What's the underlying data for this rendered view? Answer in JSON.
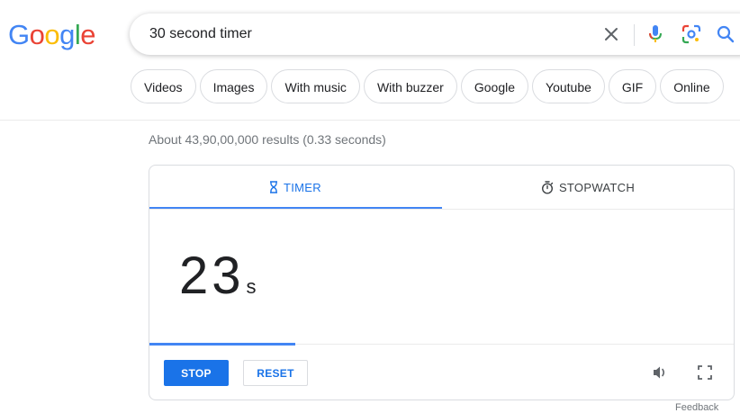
{
  "logo": {
    "text": "Google",
    "letters": [
      "G",
      "o",
      "o",
      "g",
      "l",
      "e"
    ],
    "colors": [
      "#4285F4",
      "#EA4335",
      "#FBBC05",
      "#4285F4",
      "#34A853",
      "#EA4335"
    ]
  },
  "search": {
    "query": "30 second timer"
  },
  "chips": [
    "Videos",
    "Images",
    "With music",
    "With buzzer",
    "Google",
    "Youtube",
    "GIF",
    "Online"
  ],
  "result_stats": "About 43,90,00,000 results (0.33 seconds)",
  "timer": {
    "tabs": {
      "timer": "TIMER",
      "stopwatch": "STOPWATCH"
    },
    "active_tab": "timer",
    "value": "23",
    "unit": "s",
    "progress_fraction": 0.25,
    "buttons": {
      "stop": "STOP",
      "reset": "RESET"
    }
  },
  "footer": {
    "feedback": "Feedback"
  },
  "colors": {
    "accent": "#1a73e8",
    "progress": "#4285f4"
  },
  "icons": [
    "clear-icon",
    "microphone-icon",
    "camera-lens-icon",
    "search-icon",
    "hourglass-icon",
    "stopwatch-icon",
    "volume-icon",
    "fullscreen-icon"
  ]
}
